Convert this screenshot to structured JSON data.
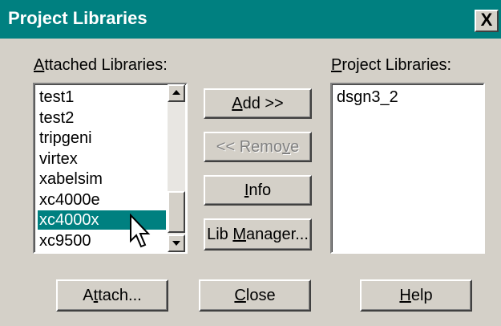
{
  "window": {
    "title": "Project Libraries",
    "close_label": "X"
  },
  "labels": {
    "attached_pre": "",
    "attached_mnemonic": "A",
    "attached_post": "ttached Libraries:",
    "project_pre": "",
    "project_mnemonic": "P",
    "project_post": "roject Libraries:"
  },
  "attached_list": {
    "items": [
      "test1",
      "test2",
      "tripgeni",
      "virtex",
      "xabelsim",
      "xc4000e",
      "xc4000x",
      "xc9500"
    ],
    "selected": "xc4000x"
  },
  "project_list": {
    "items": [
      "dsgn3_2"
    ]
  },
  "buttons": {
    "add": {
      "pre": "",
      "mn": "A",
      "post": "dd  >>"
    },
    "remove": {
      "pre": "<< Remo",
      "mn": "v",
      "post": "e"
    },
    "info": {
      "pre": "",
      "mn": "I",
      "post": "nfo"
    },
    "lib_manager": {
      "pre": "Lib ",
      "mn": "M",
      "post": "anager..."
    },
    "attach": {
      "pre": "A",
      "mn": "t",
      "post": "tach..."
    },
    "close": {
      "pre": "",
      "mn": "C",
      "post": "lose"
    },
    "help": {
      "pre": "",
      "mn": "H",
      "post": "elp"
    }
  },
  "icons": {
    "scroll_up": "triangle-up",
    "scroll_down": "triangle-down",
    "cursor": "arrow-pointer"
  }
}
